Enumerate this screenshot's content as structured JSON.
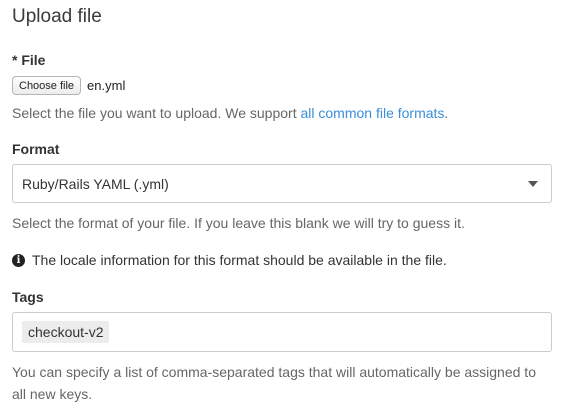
{
  "page": {
    "title": "Upload file"
  },
  "file_field": {
    "label": "* File",
    "choose_button": "Choose file",
    "file_name": "en.yml",
    "help_prefix": "Select the file you want to upload. We support ",
    "help_link": "all common file formats",
    "help_suffix": "."
  },
  "format_field": {
    "label": "Format",
    "selected": "Ruby/Rails YAML (.yml)",
    "help": "Select the format of your file. If you leave this blank we will try to guess it.",
    "info_icon": "info-circle-icon",
    "info": "The locale information for this format should be available in the file."
  },
  "tags_field": {
    "label": "Tags",
    "tags": [
      "checkout-v2"
    ],
    "help_line1": "You can specify a list of comma-separated tags that will automatically be assigned to",
    "help_line2": "all new keys."
  },
  "colors": {
    "link": "#3a8fd8",
    "help_text": "#666666",
    "border": "#cccccc"
  }
}
